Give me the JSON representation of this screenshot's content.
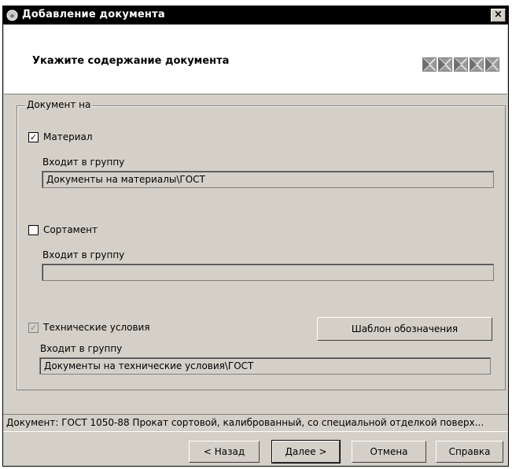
{
  "window": {
    "title": "Добавление документа",
    "close_label": "×"
  },
  "header": {
    "title": "Укажите содержание документа"
  },
  "group": {
    "legend": "Документ на",
    "material": {
      "label": "Материал",
      "checked": true,
      "belongs_label": "Входит в группу",
      "belongs_value": "Документы на материалы\\ГОСТ"
    },
    "assortment": {
      "label": "Сортамент",
      "checked": false,
      "belongs_label": "Входит в группу",
      "belongs_value": ""
    },
    "tech": {
      "label": "Технические условия",
      "checked": true,
      "disabled": true,
      "belongs_label": "Входит в группу",
      "belongs_value": "Документы на технические условия\\ГОСТ",
      "template_button": "Шаблон обозначения"
    }
  },
  "status": {
    "text": "Документ: ГОСТ 1050-88 Прокат сортовой, калиброванный, со специальной отделкой поверх..."
  },
  "buttons": {
    "back": "< Назад",
    "next": "Далее >",
    "cancel": "Отмена",
    "help": "Справка"
  }
}
